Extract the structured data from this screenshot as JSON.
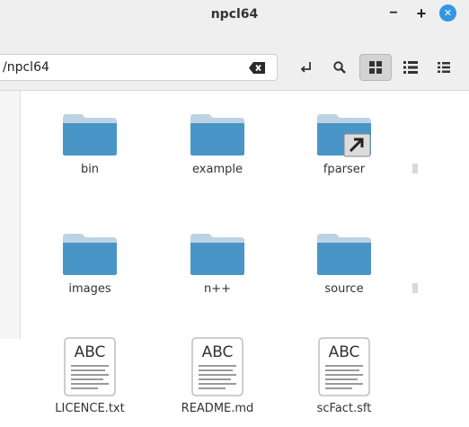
{
  "window": {
    "title": "npcl64"
  },
  "window_controls": {
    "minimize": "−",
    "maximize": "+",
    "close": "✕"
  },
  "location": {
    "path": "/npcl64"
  },
  "toolbar": {
    "buttons": [
      {
        "name": "go-to-location",
        "icon": "arrow-return-icon"
      },
      {
        "name": "search",
        "icon": "search-icon"
      },
      {
        "name": "icon-view",
        "icon": "grid-icon",
        "active": true
      },
      {
        "name": "list-view",
        "icon": "list-icon"
      },
      {
        "name": "compact-view",
        "icon": "compact-grid-icon"
      }
    ]
  },
  "files": [
    {
      "name": "bin",
      "type": "folder"
    },
    {
      "name": "example",
      "type": "folder"
    },
    {
      "name": "fparser",
      "type": "folder-link"
    },
    {
      "name": "images",
      "type": "folder"
    },
    {
      "name": "n++",
      "type": "folder"
    },
    {
      "name": "source",
      "type": "folder"
    },
    {
      "name": "LICENCE.txt",
      "type": "text",
      "preview": "ABC"
    },
    {
      "name": "README.md",
      "type": "text",
      "preview": "ABC"
    },
    {
      "name": "scFact.sft",
      "type": "text",
      "preview": "ABC"
    }
  ],
  "colors": {
    "folder": "#4a95c7",
    "folder_tab": "#bcd3e3",
    "accent": "#3296e0"
  }
}
